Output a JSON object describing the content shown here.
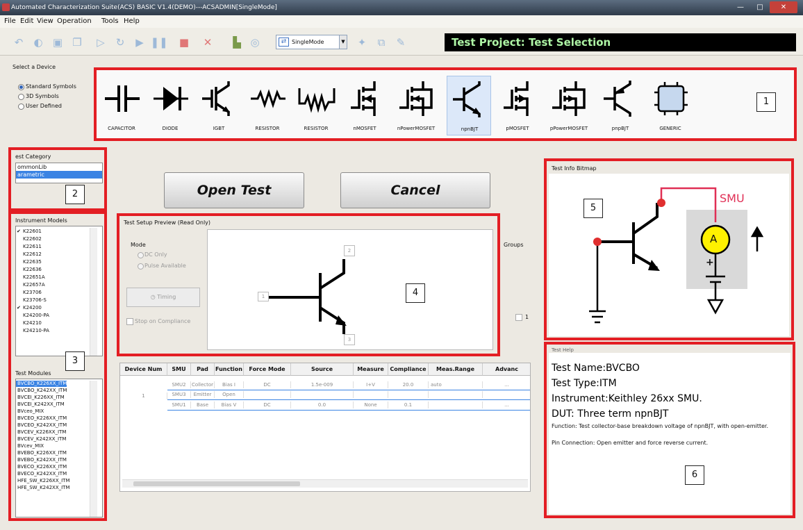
{
  "window": {
    "title": "Automated Characterization Suite(ACS) BASIC V1.4(DEMO)---ACSADMIN[SingleMode]",
    "controls": [
      "—",
      "□",
      "✕"
    ]
  },
  "menu": [
    "File",
    "Edit",
    "View",
    "Operation",
    "Tools",
    "Help"
  ],
  "toolbar": {
    "mode_value": "SingleMode",
    "icons": [
      "undo-icon",
      "open-icon",
      "save-icon",
      "save-all-icon",
      "run-icon",
      "repeat-icon",
      "append-run-icon",
      "pause-icon",
      "stop-icon",
      "delete-icon",
      "chart-icon",
      "refresh-icon",
      "mode-icon",
      "tool-icon",
      "copy-icon",
      "report-icon"
    ]
  },
  "project_title": "Test Project: Test Selection",
  "device_panel": {
    "label": "Select a Device",
    "symbol_options": [
      {
        "label": "Standard Symbols",
        "selected": true
      },
      {
        "label": "3D Symbols",
        "selected": false
      },
      {
        "label": "User Defined",
        "selected": false
      }
    ],
    "devices": [
      {
        "name": "CAPACITOR",
        "icon": "capacitor-icon",
        "selected": false
      },
      {
        "name": "DIODE",
        "icon": "diode-icon",
        "selected": false
      },
      {
        "name": "IGBT",
        "icon": "igbt-icon",
        "selected": false
      },
      {
        "name": "RESISTOR",
        "icon": "resistor-icon",
        "selected": false
      },
      {
        "name": "RESISTOR",
        "icon": "resistor-4t-icon",
        "selected": false
      },
      {
        "name": "nMOSFET",
        "icon": "nmosfet-icon",
        "selected": false
      },
      {
        "name": "nPowerMOSFET",
        "icon": "npowermosfet-icon",
        "selected": false
      },
      {
        "name": "npnBJT",
        "icon": "npnbjt-icon",
        "selected": true
      },
      {
        "name": "pMOSFET",
        "icon": "pmosfet-icon",
        "selected": false
      },
      {
        "name": "pPowerMOSFET",
        "icon": "ppowermosfet-icon",
        "selected": false
      },
      {
        "name": "pnpBJT",
        "icon": "pnpbjt-icon",
        "selected": false
      },
      {
        "name": "GENERIC",
        "icon": "generic-chip-icon",
        "selected": false
      }
    ]
  },
  "callouts": [
    "1",
    "2",
    "3",
    "4",
    "5",
    "6"
  ],
  "test_category": {
    "label": "est Category",
    "items": [
      {
        "label": "ommonLib",
        "selected": false
      },
      {
        "label": "arametric",
        "selected": true
      }
    ]
  },
  "instrument_models": {
    "label": "Instrument Models",
    "items": [
      {
        "label": "K22601",
        "checked": true
      },
      {
        "label": "K22602",
        "checked": false
      },
      {
        "label": "K22611",
        "checked": false
      },
      {
        "label": "K22612",
        "checked": false
      },
      {
        "label": "K22635",
        "checked": false
      },
      {
        "label": "K22636",
        "checked": false
      },
      {
        "label": "K22651A",
        "checked": false
      },
      {
        "label": "K22657A",
        "checked": false
      },
      {
        "label": "K23706",
        "checked": false
      },
      {
        "label": "K23706-S",
        "checked": false
      },
      {
        "label": "K24200",
        "checked": true
      },
      {
        "label": "K24200-PA",
        "checked": false
      },
      {
        "label": "K24210",
        "checked": false
      },
      {
        "label": "K24210-PA",
        "checked": false
      }
    ]
  },
  "test_modules": {
    "label": "Test Modules",
    "items": [
      {
        "label": "BVCBO_K226XX_ITM",
        "selected": true
      },
      {
        "label": "BVCBO_K242XX_ITM",
        "selected": false
      },
      {
        "label": "BVCEI_K226XX_ITM",
        "selected": false
      },
      {
        "label": "BVCEI_K242XX_ITM",
        "selected": false
      },
      {
        "label": "BVceo_MIX",
        "selected": false
      },
      {
        "label": "BVCEO_K226XX_ITM",
        "selected": false
      },
      {
        "label": "BVCEO_K242XX_ITM",
        "selected": false
      },
      {
        "label": "BVCEV_K226XX_ITM",
        "selected": false
      },
      {
        "label": "BVCEV_K242XX_ITM",
        "selected": false
      },
      {
        "label": "BVcev_MIX",
        "selected": false
      },
      {
        "label": "BVEBO_K226XX_ITM",
        "selected": false
      },
      {
        "label": "BVEBO_K242XX_ITM",
        "selected": false
      },
      {
        "label": "BVECO_K226XX_ITM",
        "selected": false
      },
      {
        "label": "BVECO_K242XX_ITM",
        "selected": false
      },
      {
        "label": "HFE_SW_K226XX_ITM",
        "selected": false
      },
      {
        "label": "HFE_SW_K242XX_ITM",
        "selected": false
      }
    ]
  },
  "buttons": {
    "open": "Open Test",
    "cancel": "Cancel"
  },
  "preview": {
    "label": "Test Setup Preview (Read Only)",
    "mode_label": "Mode",
    "mode_options": [
      {
        "label": "DC Only",
        "selected": true
      },
      {
        "label": "Pulse Available",
        "selected": false
      }
    ],
    "timing_label": "Timing",
    "stop_label": "Stop on Compliance",
    "terminals": [
      "1",
      "2",
      "3"
    ]
  },
  "groups": {
    "label": "Groups",
    "value": "1"
  },
  "table": {
    "columns": [
      "Device Num",
      "SMU",
      "Pad",
      "Function",
      "Force Mode",
      "Source",
      "Measure",
      "Compliance",
      "Meas.Range",
      "Advanc"
    ],
    "device_num": "1",
    "rows": [
      [
        "SMU2",
        "Collector",
        "Bias I",
        "DC",
        "1.5e-009",
        "I+V",
        "20.0",
        "auto",
        "..."
      ],
      [
        "SMU3",
        "Emitter",
        "Open",
        "",
        "",
        "",
        "",
        "",
        ""
      ],
      [
        "SMU1",
        "Base",
        "Bias V",
        "DC",
        "0.0",
        "None",
        "0.1",
        "",
        "..."
      ]
    ]
  },
  "info_bitmap": {
    "label": "Test Info Bitmap",
    "smu_label": "SMU",
    "meter_label": "A"
  },
  "help": {
    "label": "Test Help",
    "test_name": "Test Name:BVCBO",
    "test_type": "Test Type:ITM",
    "instrument": "Instrument:Keithley 26xx SMU.",
    "dut": "DUT: Three term npnBJT",
    "function": "Function: Test collector-base breakdown voltage of npnBJT, with open-emitter.",
    "pin_connection": "Pin Connection: Open emitter and force reverse current."
  }
}
